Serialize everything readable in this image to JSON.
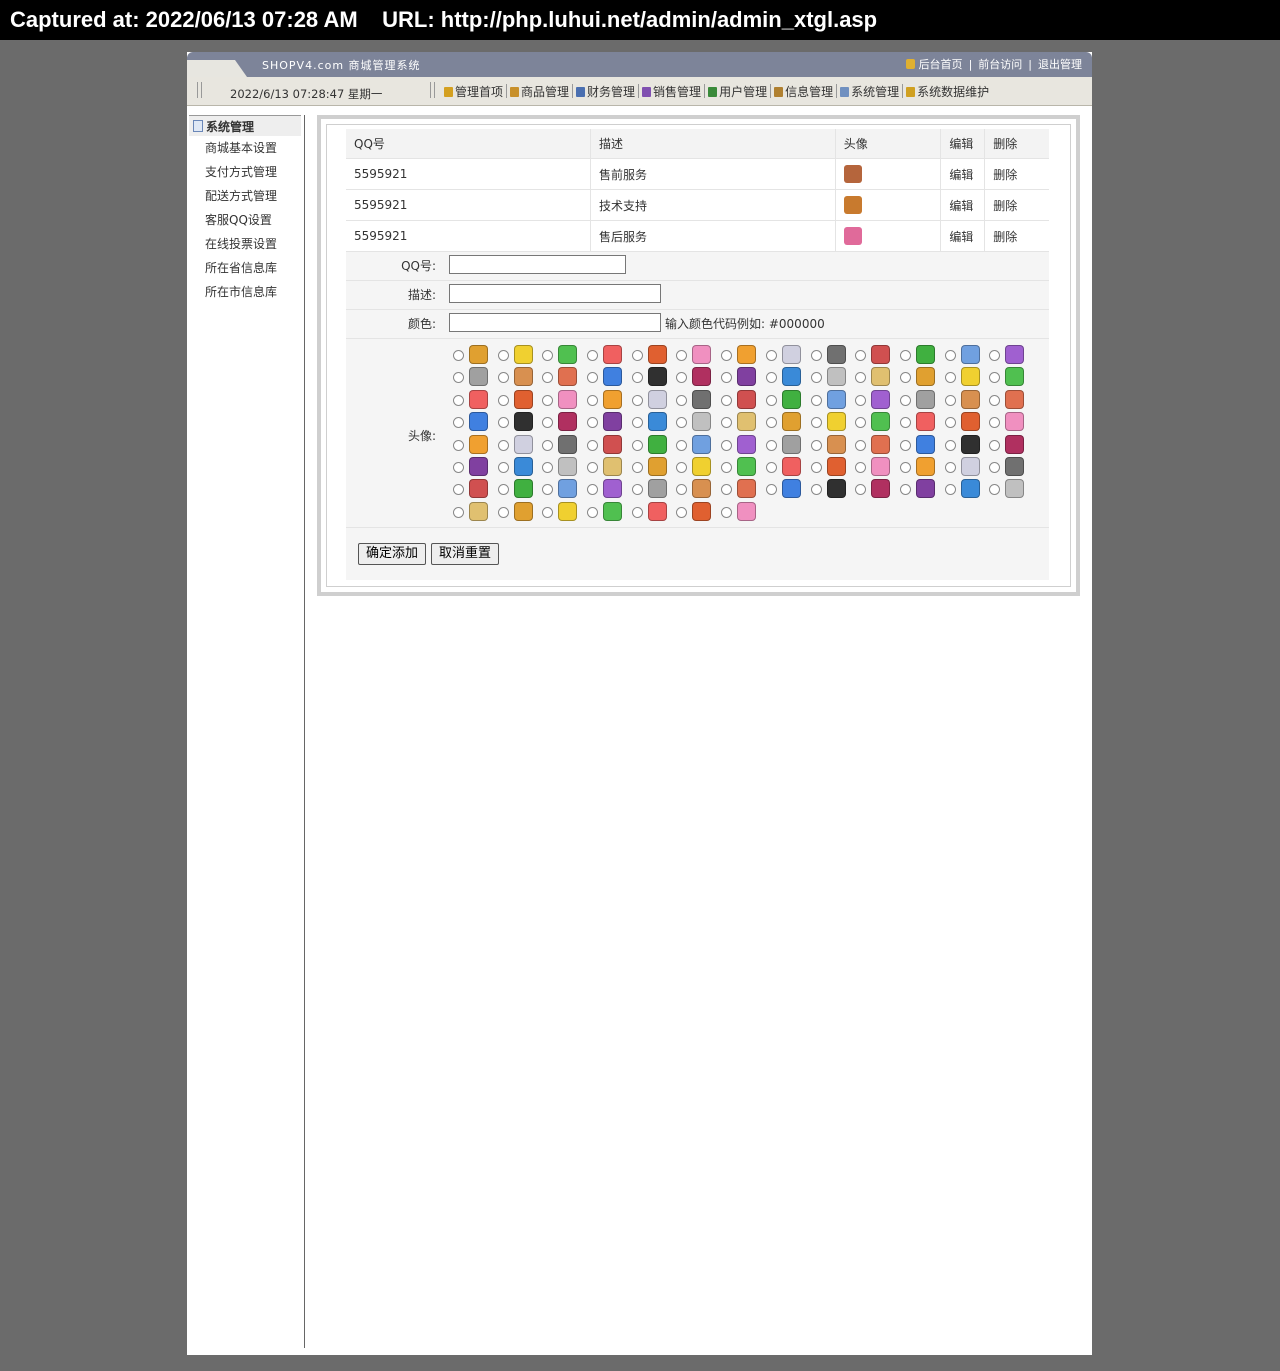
{
  "capture": {
    "text": "Captured at: 2022/06/13 07:28 AM    URL: http://php.luhui.net/admin/admin_xtgl.asp"
  },
  "header": {
    "brand": "SHOPV4.com 商城管理系统",
    "links": [
      "后台首页",
      "前台访问",
      "退出管理"
    ],
    "datetime": "2022/6/13 07:28:47 星期一"
  },
  "menu": [
    {
      "label": "管理首项",
      "color": "#d4a020"
    },
    {
      "label": "商品管理",
      "color": "#c8902a"
    },
    {
      "label": "财务管理",
      "color": "#4a6fb0"
    },
    {
      "label": "销售管理",
      "color": "#8050b0"
    },
    {
      "label": "用户管理",
      "color": "#3a8a3a"
    },
    {
      "label": "信息管理",
      "color": "#b08030"
    },
    {
      "label": "系统管理",
      "color": "#7090c0"
    },
    {
      "label": "系统数据维护",
      "color": "#d0a020"
    }
  ],
  "sidebar": {
    "title": "系统管理",
    "items": [
      "商城基本设置",
      "支付方式管理",
      "配送方式管理",
      "客服QQ设置",
      "在线投票设置",
      "所在省信息库",
      "所在市信息库"
    ]
  },
  "table": {
    "headers": [
      "QQ号",
      "描述",
      "头像",
      "编辑",
      "删除"
    ],
    "rows": [
      {
        "qq": "5595921",
        "desc": "售前服务",
        "face_color": "#b5653c",
        "edit": "编辑",
        "del": "删除"
      },
      {
        "qq": "5595921",
        "desc": "技术支持",
        "face_color": "#c87a2e",
        "edit": "编辑",
        "del": "删除"
      },
      {
        "qq": "5595921",
        "desc": "售后服务",
        "face_color": "#e06a9a",
        "edit": "编辑",
        "del": "删除"
      }
    ]
  },
  "form": {
    "qq_label": "QQ号:",
    "qq_value": "",
    "desc_label": "描述:",
    "desc_value": "",
    "color_label": "颜色:",
    "color_value": "",
    "color_hint": "输入颜色代码例如: #000000",
    "avatar_label": "头像:",
    "avatar_count": 98,
    "submit": "确定添加",
    "reset": "取消重置"
  },
  "colors": {
    "frame_bg": "#6b6b6b",
    "topbar": "#7d8499",
    "navbar": "#e8e6df"
  }
}
